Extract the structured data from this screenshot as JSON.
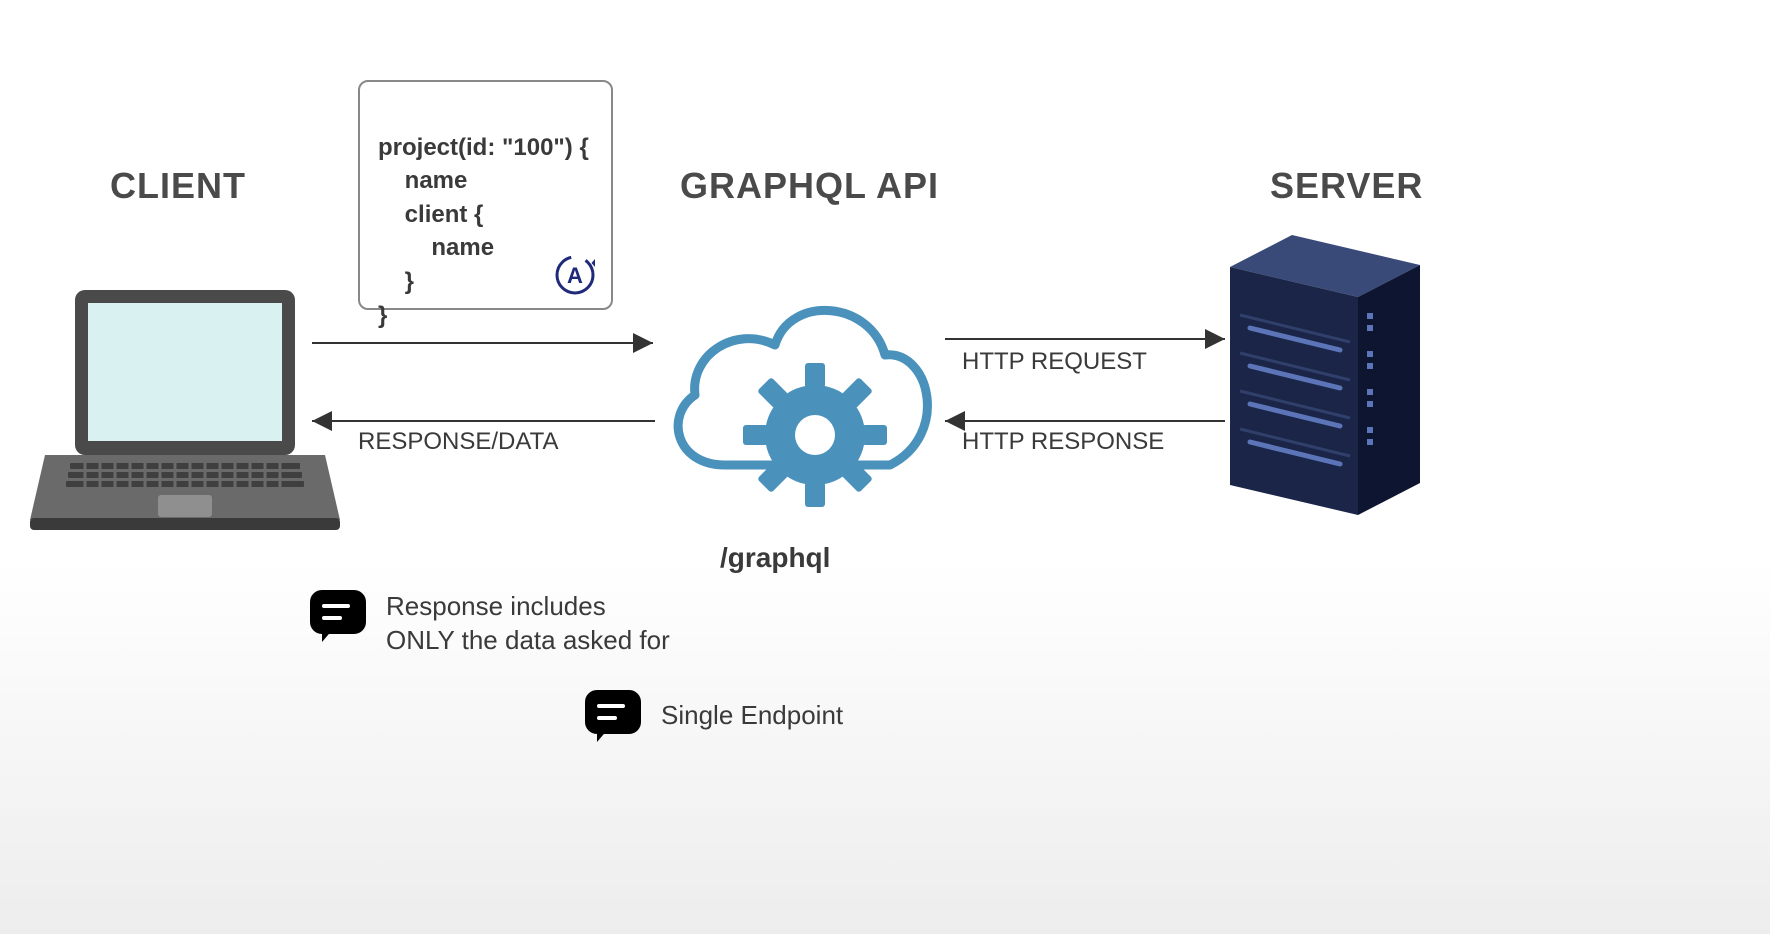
{
  "titles": {
    "client": "CLIENT",
    "api": "GRAPHQL API",
    "server": "SERVER"
  },
  "code": {
    "line1": "project(id: \"100\") {",
    "line2": "    name",
    "line3": "    client {",
    "line4": "        name",
    "line5": "    }",
    "line6": "}",
    "badge": "A"
  },
  "arrows": {
    "response_data": "RESPONSE/DATA",
    "http_request": "HTTP REQUEST",
    "http_response": "HTTP RESPONSE"
  },
  "endpoint": "/graphql",
  "notes": {
    "note1": "Response includes\nONLY the data asked for",
    "note2": "Single Endpoint"
  }
}
